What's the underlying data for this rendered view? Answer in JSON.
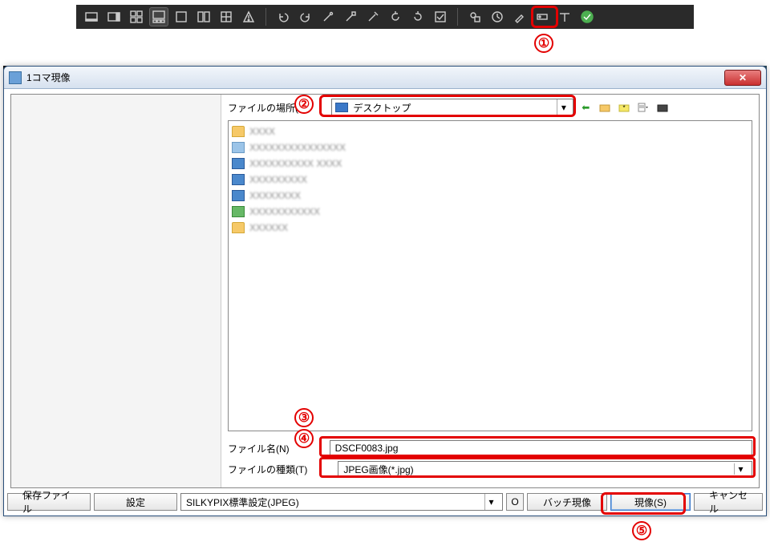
{
  "toolbar": {
    "buttons": [
      "layout-a",
      "layout-b",
      "grid-4",
      "grid-active",
      "rect-1",
      "rect-2",
      "grid-plus",
      "warning",
      "undo",
      "redo",
      "wand-a",
      "wand-b",
      "wand-c",
      "rotate-l",
      "rotate-r",
      "check",
      "develop-gear",
      "clock",
      "brush",
      "label",
      "tee",
      "ok-green"
    ]
  },
  "callouts": {
    "c1": "①",
    "c2": "②",
    "c3": "③",
    "c4": "④",
    "c5": "⑤"
  },
  "dialog": {
    "title": "1コマ現像",
    "location_label": "ファイルの場所(I)",
    "location_value": "デスクトップ",
    "filename_label": "ファイル名(N)",
    "filename_value": "DSCF0083.jpg",
    "filetype_label": "ファイルの種類(T)",
    "filetype_value": "JPEG画像(*.jpg)",
    "files": [
      "",
      "",
      "",
      "",
      "",
      "",
      ""
    ]
  },
  "bottom": {
    "save_file": "保存ファイル",
    "settings": "設定",
    "preset": "SILKYPIX標準設定(JPEG)",
    "opts": "O",
    "batch": "バッチ現像",
    "develop": "現像(S)",
    "cancel": "キャンセル"
  }
}
